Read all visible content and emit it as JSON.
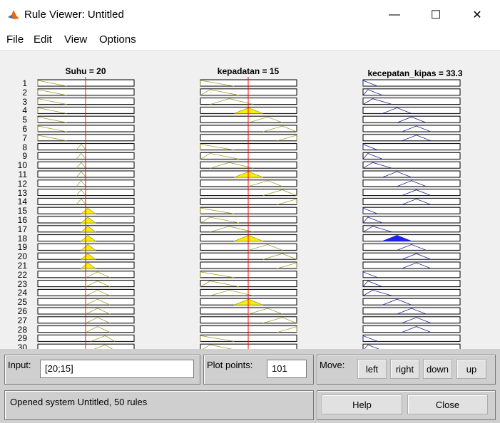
{
  "window": {
    "title": "Rule Viewer: Untitled",
    "minimize_glyph": "—",
    "maximize_glyph": "☐",
    "close_glyph": "✕"
  },
  "menu": {
    "items": [
      "File",
      "Edit",
      "View",
      "Options"
    ]
  },
  "inputs_panel": [
    {
      "title": "Suhu = 20",
      "value": 20,
      "range": [
        0,
        50
      ],
      "type": "input"
    },
    {
      "title": "kepadatan = 15",
      "value": 15,
      "range": [
        0,
        30
      ],
      "type": "input"
    },
    {
      "title": "kecepatan_kipas = 33.3",
      "value": 33.3,
      "range": [
        0,
        100
      ],
      "type": "output"
    }
  ],
  "rules": {
    "count": 50,
    "visible_numbers": [
      "1",
      "2",
      "3",
      "4",
      "5",
      "6",
      "7",
      "8",
      "9",
      "10",
      "11",
      "12",
      "13",
      "14",
      "15",
      "16",
      "17",
      "18",
      "19",
      "20",
      "21",
      "22",
      "23",
      "24",
      "25",
      "26",
      "27",
      "28",
      "29",
      "30"
    ]
  },
  "controls": {
    "input_label": "Input:",
    "input_value": "[20;15]",
    "plot_points_label": "Plot points:",
    "plot_points_value": "101",
    "move_label": "Move:",
    "move_buttons": [
      "left",
      "right",
      "down",
      "up"
    ],
    "status": "Opened system Untitled, 50 rules",
    "help_label": "Help",
    "close_label": "Close"
  },
  "colors": {
    "input_fill": "#ffee00",
    "input_line": "#a0a030",
    "output_fill": "#2020ff",
    "output_line": "#2020a0",
    "value_line": "#ff0000"
  },
  "icons": {
    "app": "matlab-icon"
  }
}
